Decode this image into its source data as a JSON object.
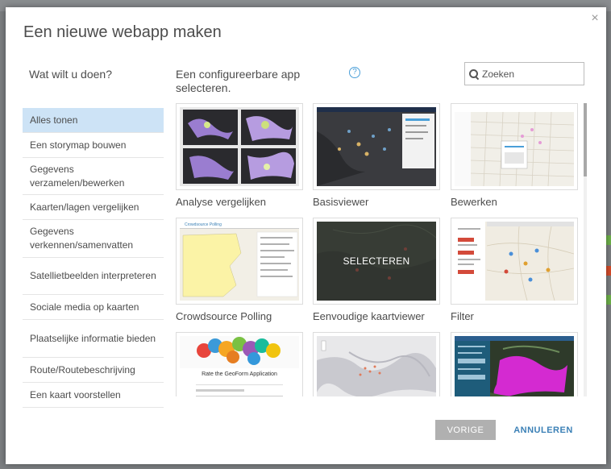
{
  "dialog": {
    "title": "Een nieuwe webapp maken",
    "close_symbol": "×"
  },
  "left_panel": {
    "heading": "Wat wilt u doen?",
    "categories": [
      {
        "label": "Alles tonen",
        "active": true
      },
      {
        "label": "Een storymap bouwen"
      },
      {
        "label": "Gegevens verzamelen/bewerken"
      },
      {
        "label": "Kaarten/lagen vergelijken"
      },
      {
        "label": "Gegevens verkennen/samenvatten"
      },
      {
        "label": "Satellietbeelden interpreteren"
      },
      {
        "label": "Sociale media op kaarten"
      },
      {
        "label": "Plaatselijke informatie bieden"
      },
      {
        "label": "Route/Routebeschrijving"
      },
      {
        "label": "Een kaart voorstellen"
      }
    ]
  },
  "main": {
    "heading": "Een configureerbare app selecteren.",
    "help_symbol": "?",
    "search": {
      "placeholder": "Zoeken",
      "value": ""
    },
    "apps": [
      {
        "label": "Analyse vergelijken"
      },
      {
        "label": "Basisviewer"
      },
      {
        "label": "Bewerken"
      },
      {
        "label": "Crowdsource Polling",
        "thumb_title": "Crowdsource Polling"
      },
      {
        "label": "Eenvoudige kaartviewer",
        "hover_label": "SELECTEREN"
      },
      {
        "label": "Filter"
      },
      {
        "label": "",
        "thumb_title": "Rate the GeoForm Application"
      },
      {
        "label": ""
      },
      {
        "label": ""
      }
    ]
  },
  "footer": {
    "prev_label": "VORIGE",
    "cancel_label": "ANNULEREN"
  },
  "colors": {
    "accent": "#3b80b6",
    "active_category": "#cde3f6",
    "disabled_button": "#b0b0b0",
    "help_icon": "#4a9fd8"
  },
  "icons": [
    "close-icon",
    "help-icon",
    "search-icon"
  ]
}
